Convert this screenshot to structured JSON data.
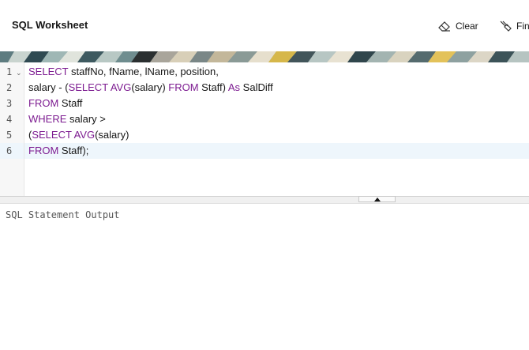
{
  "header": {
    "title": "SQL Worksheet",
    "clear_label": "Clear",
    "find_label": "Fin"
  },
  "editor": {
    "line_numbers": [
      "1",
      "2",
      "3",
      "4",
      "5",
      "6"
    ],
    "lines": [
      [
        {
          "t": "kw",
          "v": "SELECT"
        },
        {
          "t": "tx",
          "v": " staffNo, fName, lName, position,"
        }
      ],
      [
        {
          "t": "tx",
          "v": "salary - ("
        },
        {
          "t": "kw",
          "v": "SELECT"
        },
        {
          "t": "tx",
          "v": " "
        },
        {
          "t": "kw",
          "v": "AVG"
        },
        {
          "t": "tx",
          "v": "(salary) "
        },
        {
          "t": "kw",
          "v": "FROM"
        },
        {
          "t": "tx",
          "v": " Staff) "
        },
        {
          "t": "kw",
          "v": "As"
        },
        {
          "t": "tx",
          "v": " SalDiff"
        }
      ],
      [
        {
          "t": "kw",
          "v": "FROM"
        },
        {
          "t": "tx",
          "v": " Staff"
        }
      ],
      [
        {
          "t": "kw",
          "v": "WHERE"
        },
        {
          "t": "tx",
          "v": " salary >"
        }
      ],
      [
        {
          "t": "tx",
          "v": "("
        },
        {
          "t": "kw",
          "v": "SELECT"
        },
        {
          "t": "tx",
          "v": " "
        },
        {
          "t": "kw",
          "v": "AVG"
        },
        {
          "t": "tx",
          "v": "(salary)"
        }
      ],
      [
        {
          "t": "kw",
          "v": "FROM"
        },
        {
          "t": "tx",
          "v": " Staff);"
        }
      ]
    ],
    "active_line": 6,
    "keyword_color": "#7d1c91"
  },
  "output": {
    "label": "SQL Statement Output"
  },
  "icons": {
    "clear": "eraser-icon",
    "find": "find-icon",
    "fold": "chevron-down-icon",
    "splitter": "triangle-up-icon"
  }
}
